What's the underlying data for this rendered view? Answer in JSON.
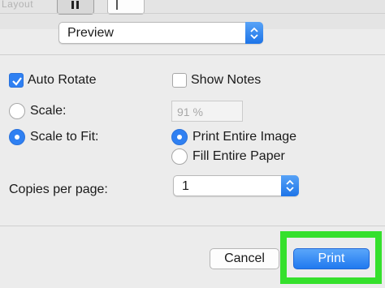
{
  "top": {
    "cut_label": "Layout",
    "orientation_buttons": [
      "portrait",
      "landscape"
    ]
  },
  "app_section": {
    "selected": "Preview",
    "icon": "chevron-up-down-icon"
  },
  "options": {
    "auto_rotate": {
      "label": "Auto Rotate",
      "checked": true
    },
    "show_notes": {
      "label": "Show Notes",
      "checked": false
    },
    "scale": {
      "label": "Scale:",
      "selected": false,
      "value": "91 %"
    },
    "scale_to_fit": {
      "label": "Scale to Fit:",
      "selected": true
    },
    "print_entire_image": {
      "label": "Print Entire Image",
      "selected": true
    },
    "fill_entire_paper": {
      "label": "Fill Entire Paper",
      "selected": false
    },
    "copies_per_page": {
      "label": "Copies per page:",
      "value": "1"
    }
  },
  "buttons": {
    "cancel": "Cancel",
    "print": "Print"
  },
  "colors": {
    "accent": "#2f80f2",
    "highlight": "#35e02c",
    "background": "#ececec"
  }
}
